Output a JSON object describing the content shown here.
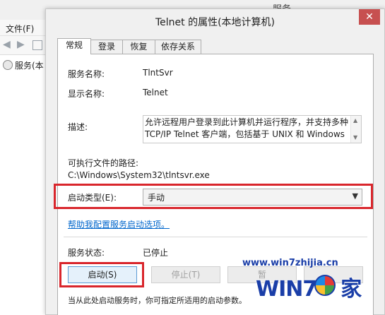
{
  "background_window": {
    "title": "服务",
    "menu_file": "文件(F)",
    "tree_item": "服务(本"
  },
  "dialog": {
    "title": "Telnet 的属性(本地计算机)",
    "close_glyph": "✕",
    "tabs": [
      {
        "label": "常规",
        "active": true
      },
      {
        "label": "登录",
        "active": false
      },
      {
        "label": "恢复",
        "active": false
      },
      {
        "label": "依存关系",
        "active": false
      }
    ],
    "general": {
      "service_name_label": "服务名称:",
      "service_name_value": "TlntSvr",
      "display_name_label": "显示名称:",
      "display_name_value": "Telnet",
      "description_label": "描述:",
      "description_value": "允许远程用户登录到此计算机并运行程序，并支持多种 TCP/IP Telnet 客户端，包括基于 UNIX 和 Windows",
      "exe_path_label": "可执行文件的路径:",
      "exe_path_value": "C:\\Windows\\System32\\tlntsvr.exe",
      "startup_type_label": "启动类型(E):",
      "startup_type_value": "手动",
      "help_link": "帮助我配置服务启动选项。",
      "service_status_label": "服务状态:",
      "service_status_value": "已停止",
      "buttons": {
        "start": "启动(S)",
        "stop": "停止(T)",
        "pause": "暂",
        "resume": ""
      },
      "start_params_note": "当从此处启动服务时，你可指定所适用的启动参数。"
    },
    "highlight_color": "#d9262c"
  },
  "watermark": {
    "url": "www.win7zhijia.cn",
    "logo_text": "WIN7",
    "logo_suffix": "家"
  }
}
